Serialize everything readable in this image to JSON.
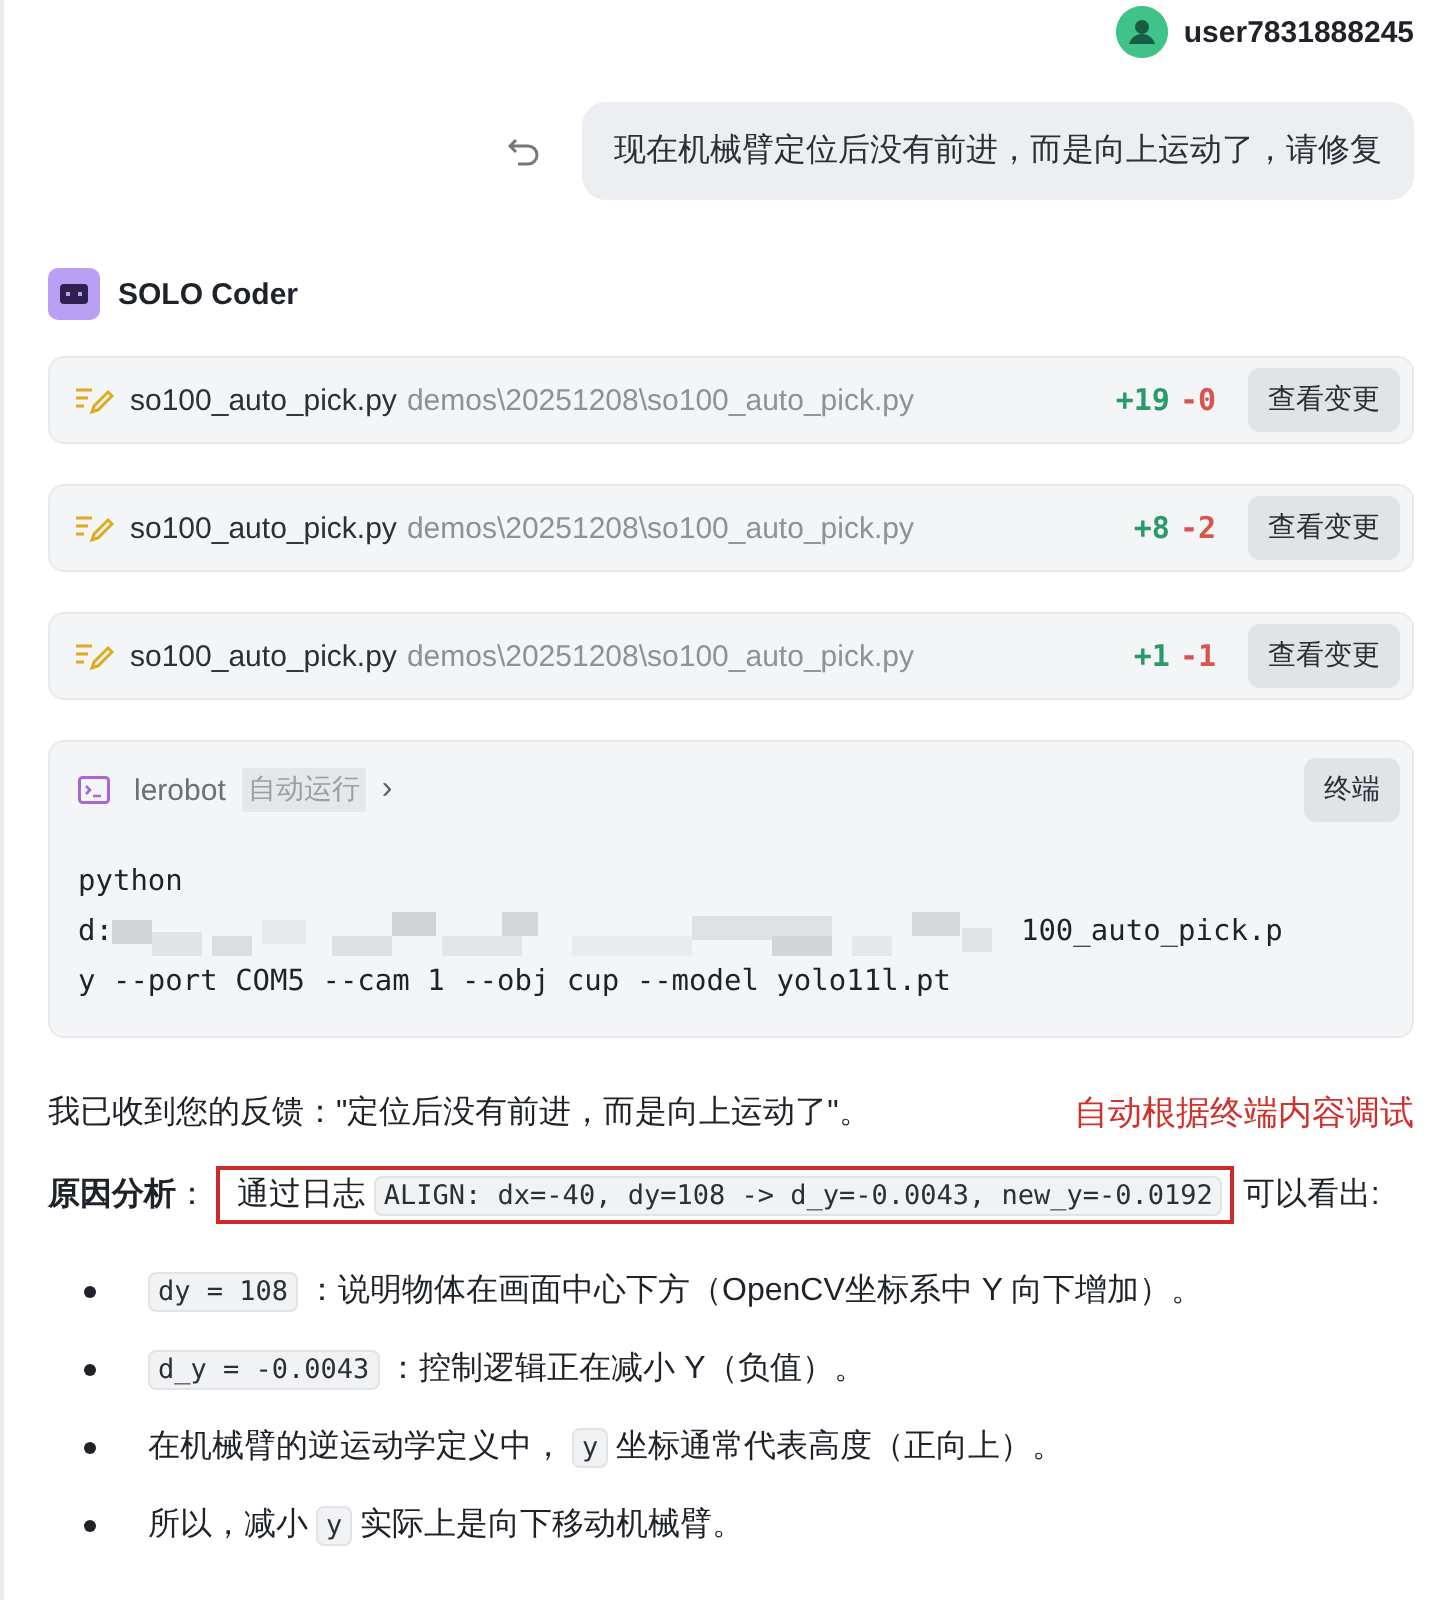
{
  "user": {
    "name": "user7831888245"
  },
  "user_message": {
    "text": "现在机械臂定位后没有前进，而是向上运动了，请修复"
  },
  "agent": {
    "name": "SOLO Coder"
  },
  "file_changes": [
    {
      "file": "so100_auto_pick.py",
      "path": "demos\\20251208\\so100_auto_pick.py",
      "added": "+19",
      "removed": "-0",
      "button": "查看变更"
    },
    {
      "file": "so100_auto_pick.py",
      "path": "demos\\20251208\\so100_auto_pick.py",
      "added": "+8",
      "removed": "-2",
      "button": "查看变更"
    },
    {
      "file": "so100_auto_pick.py",
      "path": "demos\\20251208\\so100_auto_pick.py",
      "added": "+1",
      "removed": "-1",
      "button": "查看变更"
    }
  ],
  "terminal": {
    "name": "lerobot",
    "tag": "自动运行",
    "chevron": "›",
    "button": "终端",
    "lines": [
      [
        {
          "kind": "text",
          "text": "python"
        }
      ],
      [
        {
          "kind": "text",
          "text": "d:"
        },
        {
          "kind": "redacted"
        },
        {
          "kind": "text",
          "text": "100_auto_pick.p"
        }
      ],
      [
        {
          "kind": "text",
          "text": "y --port COM5 --cam 1 --obj cup --model yolo11l.pt"
        }
      ]
    ]
  },
  "feedback": {
    "text": "我已收到您的反馈：\"定位后没有前进，而是向上运动了\"。",
    "annotation": "自动根据终端内容调试"
  },
  "analysis": {
    "label": "原因分析",
    "separator": "：",
    "highlight_text": "通过日志",
    "highlight_code": "ALIGN: dx=-40, dy=108 -> d_y=-0.0043, new_y=-0.0192",
    "rest": "可以看出:"
  },
  "bullets": [
    [
      {
        "kind": "code",
        "text": "dy = 108"
      },
      {
        "kind": "text",
        "text": "：说明物体在画面中心下方（OpenCV坐标系中 Y 向下增加）。"
      }
    ],
    [
      {
        "kind": "code",
        "text": "d_y = -0.0043"
      },
      {
        "kind": "text",
        "text": "：控制逻辑正在减小 Y（负值）。"
      }
    ],
    [
      {
        "kind": "text",
        "text": "在机械臂的逆运动学定义中，"
      },
      {
        "kind": "code",
        "text": "y"
      },
      {
        "kind": "text",
        "text": "坐标通常代表高度（正向上）。"
      }
    ],
    [
      {
        "kind": "text",
        "text": "所以，减小"
      },
      {
        "kind": "code",
        "text": "y"
      },
      {
        "kind": "text",
        "text": "实际上是向下移动机械臂。"
      }
    ]
  ]
}
